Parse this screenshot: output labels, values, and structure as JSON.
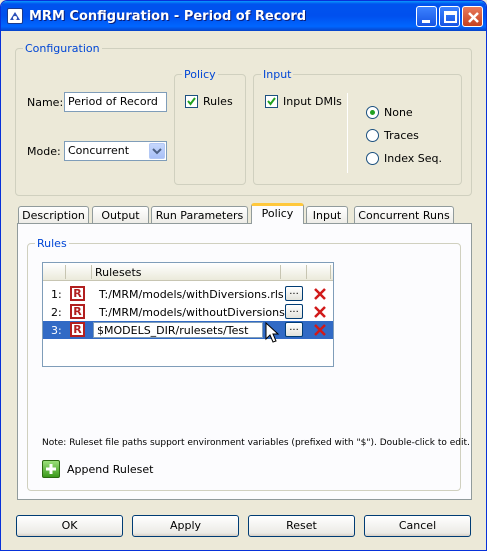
{
  "window": {
    "title": "MRM Configuration - Period of Record"
  },
  "configuration": {
    "label": "Configuration",
    "name_label": "Name:",
    "name_value": "Period of Record",
    "mode_label": "Mode:",
    "mode_value": "Concurrent"
  },
  "policy_group": {
    "label": "Policy",
    "rules_label": "Rules",
    "rules_checked": true
  },
  "input_group": {
    "label": "Input",
    "input_dmis_label": "Input DMIs",
    "input_dmis_checked": true,
    "radios": [
      {
        "label": "None",
        "selected": true
      },
      {
        "label": "Traces",
        "selected": false
      },
      {
        "label": "Index Seq.",
        "selected": false
      }
    ]
  },
  "tabs": [
    "Description",
    "Output",
    "Run Parameters",
    "Policy",
    "Input",
    "Concurrent Runs"
  ],
  "active_tab": "Policy",
  "rules": {
    "label": "Rules",
    "column_header": "Rulesets",
    "rows": [
      {
        "num": "1:",
        "icon": "R",
        "path": "T:/MRM/models/withDiversions.rls"
      },
      {
        "num": "2:",
        "icon": "R",
        "path": "T:/MRM/models/withoutDiversions.rls"
      },
      {
        "num": "3:",
        "icon": "R",
        "path": "$MODELS_DIR/rulesets/Test"
      }
    ],
    "browse_label": "...",
    "selected_row": 3,
    "note": "Note: Ruleset file paths support environment variables (prefixed with \"$\"). Double-click to edit.",
    "append_label": "Append Ruleset"
  },
  "buttons": {
    "ok": "OK",
    "apply": "Apply",
    "reset": "Reset",
    "cancel": "Cancel"
  },
  "colors": {
    "title_bar": "#0053ee",
    "selection": "#316ac5",
    "group_label": "#0046d5",
    "delete_x": "#d11a1a"
  }
}
